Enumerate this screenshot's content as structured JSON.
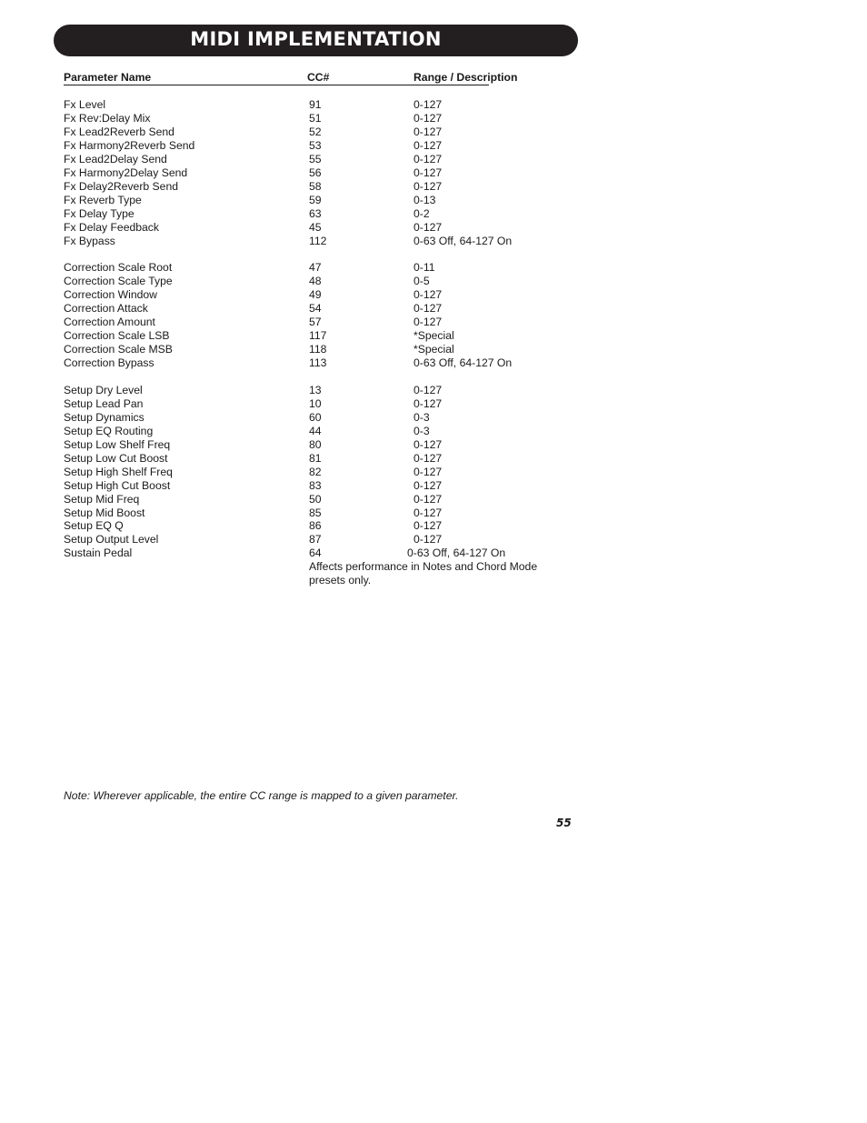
{
  "title": "MIDI IMPLEMENTATION",
  "table": {
    "headers": {
      "name": "Parameter Name",
      "cc": "CC#",
      "range": "Range / Description"
    },
    "groups": [
      {
        "rows": [
          {
            "name": "Fx Level",
            "cc": "91",
            "range": "0-127"
          },
          {
            "name": "Fx Rev:Delay Mix",
            "cc": "51",
            "range": "0-127"
          },
          {
            "name": "Fx Lead2Reverb Send",
            "cc": "52",
            "range": "0-127"
          },
          {
            "name": "Fx Harmony2Reverb Send",
            "cc": "53",
            "range": "0-127"
          },
          {
            "name": "Fx Lead2Delay Send",
            "cc": "55",
            "range": "0-127"
          },
          {
            "name": "Fx Harmony2Delay Send",
            "cc": "56",
            "range": "0-127"
          },
          {
            "name": "Fx Delay2Reverb Send",
            "cc": "58",
            "range": "0-127"
          },
          {
            "name": "Fx Reverb Type",
            "cc": "59",
            "range": "0-13"
          },
          {
            "name": "Fx Delay Type",
            "cc": "63",
            "range": "0-2"
          },
          {
            "name": "Fx Delay Feedback",
            "cc": "45",
            "range": "0-127"
          },
          {
            "name": "Fx Bypass",
            "cc": "112",
            "range": "0-63 Off, 64-127 On"
          }
        ]
      },
      {
        "rows": [
          {
            "name": "Correction Scale Root",
            "cc": "47",
            "range": "0-11"
          },
          {
            "name": "Correction Scale Type",
            "cc": "48",
            "range": "0-5"
          },
          {
            "name": "Correction Window",
            "cc": "49",
            "range": "0-127"
          },
          {
            "name": "Correction Attack",
            "cc": "54",
            "range": "0-127"
          },
          {
            "name": "Correction Amount",
            "cc": "57",
            "range": "0-127"
          },
          {
            "name": "Correction Scale LSB",
            "cc": "117",
            "range": "*Special"
          },
          {
            "name": "Correction Scale MSB",
            "cc": "118",
            "range": "*Special"
          },
          {
            "name": "Correction Bypass",
            "cc": "113",
            "range": "0-63 Off, 64-127 On"
          }
        ]
      },
      {
        "rows": [
          {
            "name": "Setup Dry Level",
            "cc": "13",
            "range": "0-127"
          },
          {
            "name": "Setup Lead Pan",
            "cc": "10",
            "range": "0-127"
          },
          {
            "name": "Setup Dynamics",
            "cc": "60",
            "range": "0-3"
          },
          {
            "name": "Setup EQ Routing",
            "cc": "44",
            "range": "0-3"
          },
          {
            "name": "Setup Low Shelf Freq",
            "cc": "80",
            "range": "0-127"
          },
          {
            "name": "Setup Low Cut Boost",
            "cc": "81",
            "range": "0-127"
          },
          {
            "name": "Setup High Shelf Freq",
            "cc": "82",
            "range": "0-127"
          },
          {
            "name": "Setup High Cut Boost",
            "cc": "83",
            "range": "0-127"
          },
          {
            "name": "Setup Mid Freq",
            "cc": "50",
            "range": "0-127"
          },
          {
            "name": "Setup Mid Boost",
            "cc": "85",
            "range": "0-127"
          },
          {
            "name": "Setup EQ Q",
            "cc": "86",
            "range": "0-127"
          },
          {
            "name": "Setup Output Level",
            "cc": "87",
            "range": "0-127"
          },
          {
            "name": "Sustain Pedal",
            "cc": "64",
            "range": "0-63 Off, 64-127 On"
          }
        ]
      }
    ],
    "sustain_note_line1": "Affects performance in Notes and Chord Mode",
    "sustain_note_line2": "presets only."
  },
  "footnote": "Note: Wherever applicable, the entire CC range is mapped to a given parameter.",
  "page_number": "55"
}
